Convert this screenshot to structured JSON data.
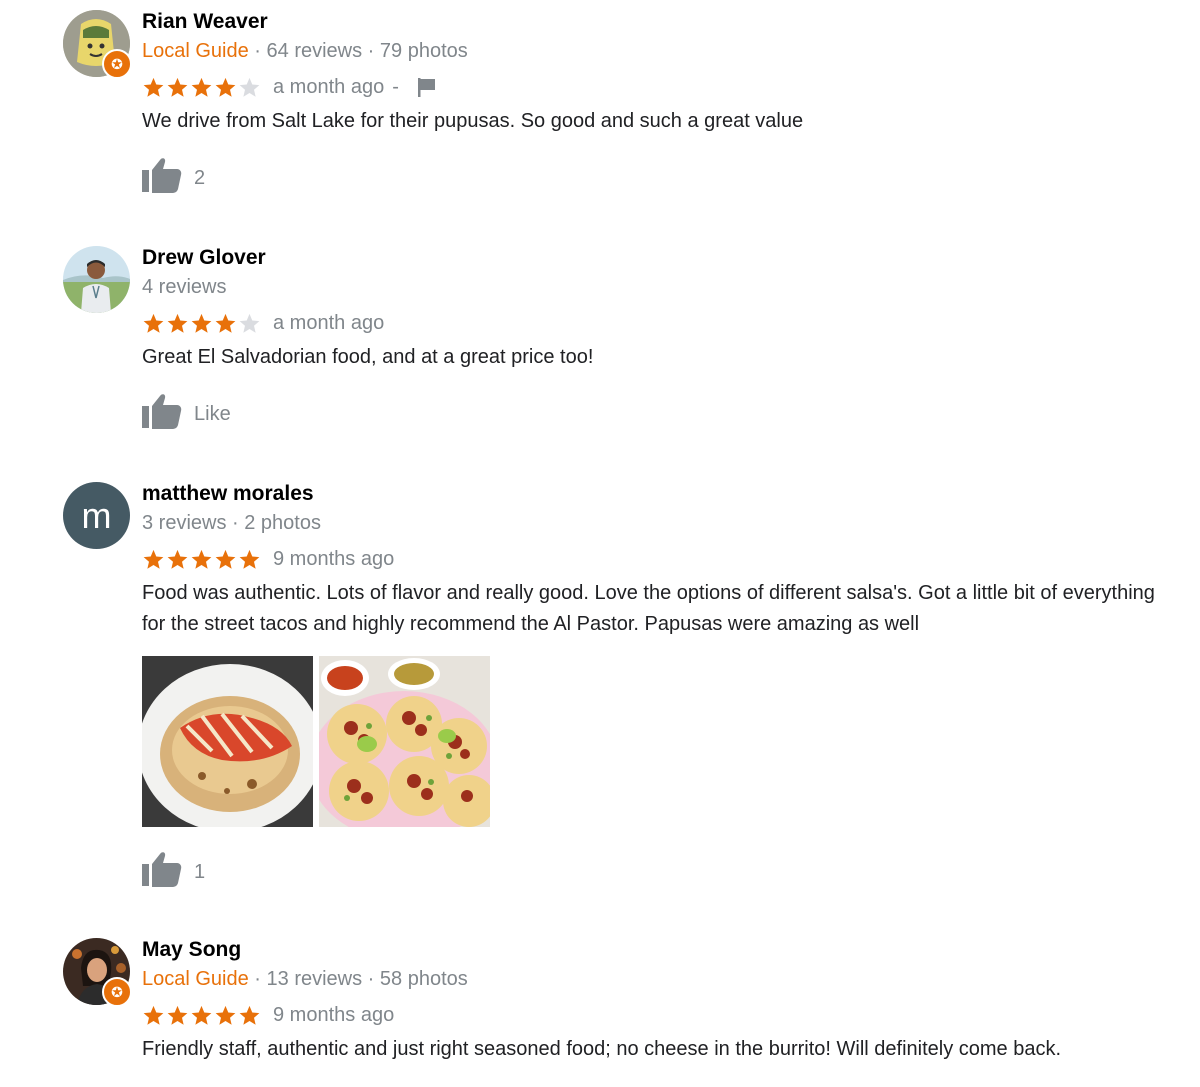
{
  "colors": {
    "star": "#e8710a",
    "star_empty": "#dadce0",
    "guide": "#e8710a",
    "muted": "#80868b"
  },
  "reviews": [
    {
      "name": "Rian Weaver",
      "guide_label": "Local Guide",
      "meta": " · 64 reviews · 79 photos",
      "rating": 4,
      "time": "a month ago",
      "flag_sep": "-",
      "text": "We drive from Salt Lake for their pupusas.  So good and such a great value",
      "likes": "2"
    },
    {
      "name": "Drew Glover",
      "meta": "4 reviews",
      "rating": 4,
      "time": "a month ago",
      "text": "Great El Salvadorian food, and at a great price too!",
      "likes": "Like"
    },
    {
      "name": "matthew morales",
      "avatar_letter": "m",
      "meta": "3 reviews · 2 photos",
      "rating": 5,
      "time": "9 months ago",
      "text": "Food was authentic. Lots of flavor and really good. Love the options of different salsa's. Got a little bit of everything for the street tacos and highly recommend the Al Pastor. Papusas were amazing as well",
      "likes": "1"
    },
    {
      "name": "May Song",
      "guide_label": "Local Guide",
      "meta": " · 13 reviews · 58 photos",
      "rating": 5,
      "time": "9 months ago",
      "text": "Friendly staff, authentic and just right seasoned food; no cheese in the burrito! Will definitely come back."
    }
  ]
}
